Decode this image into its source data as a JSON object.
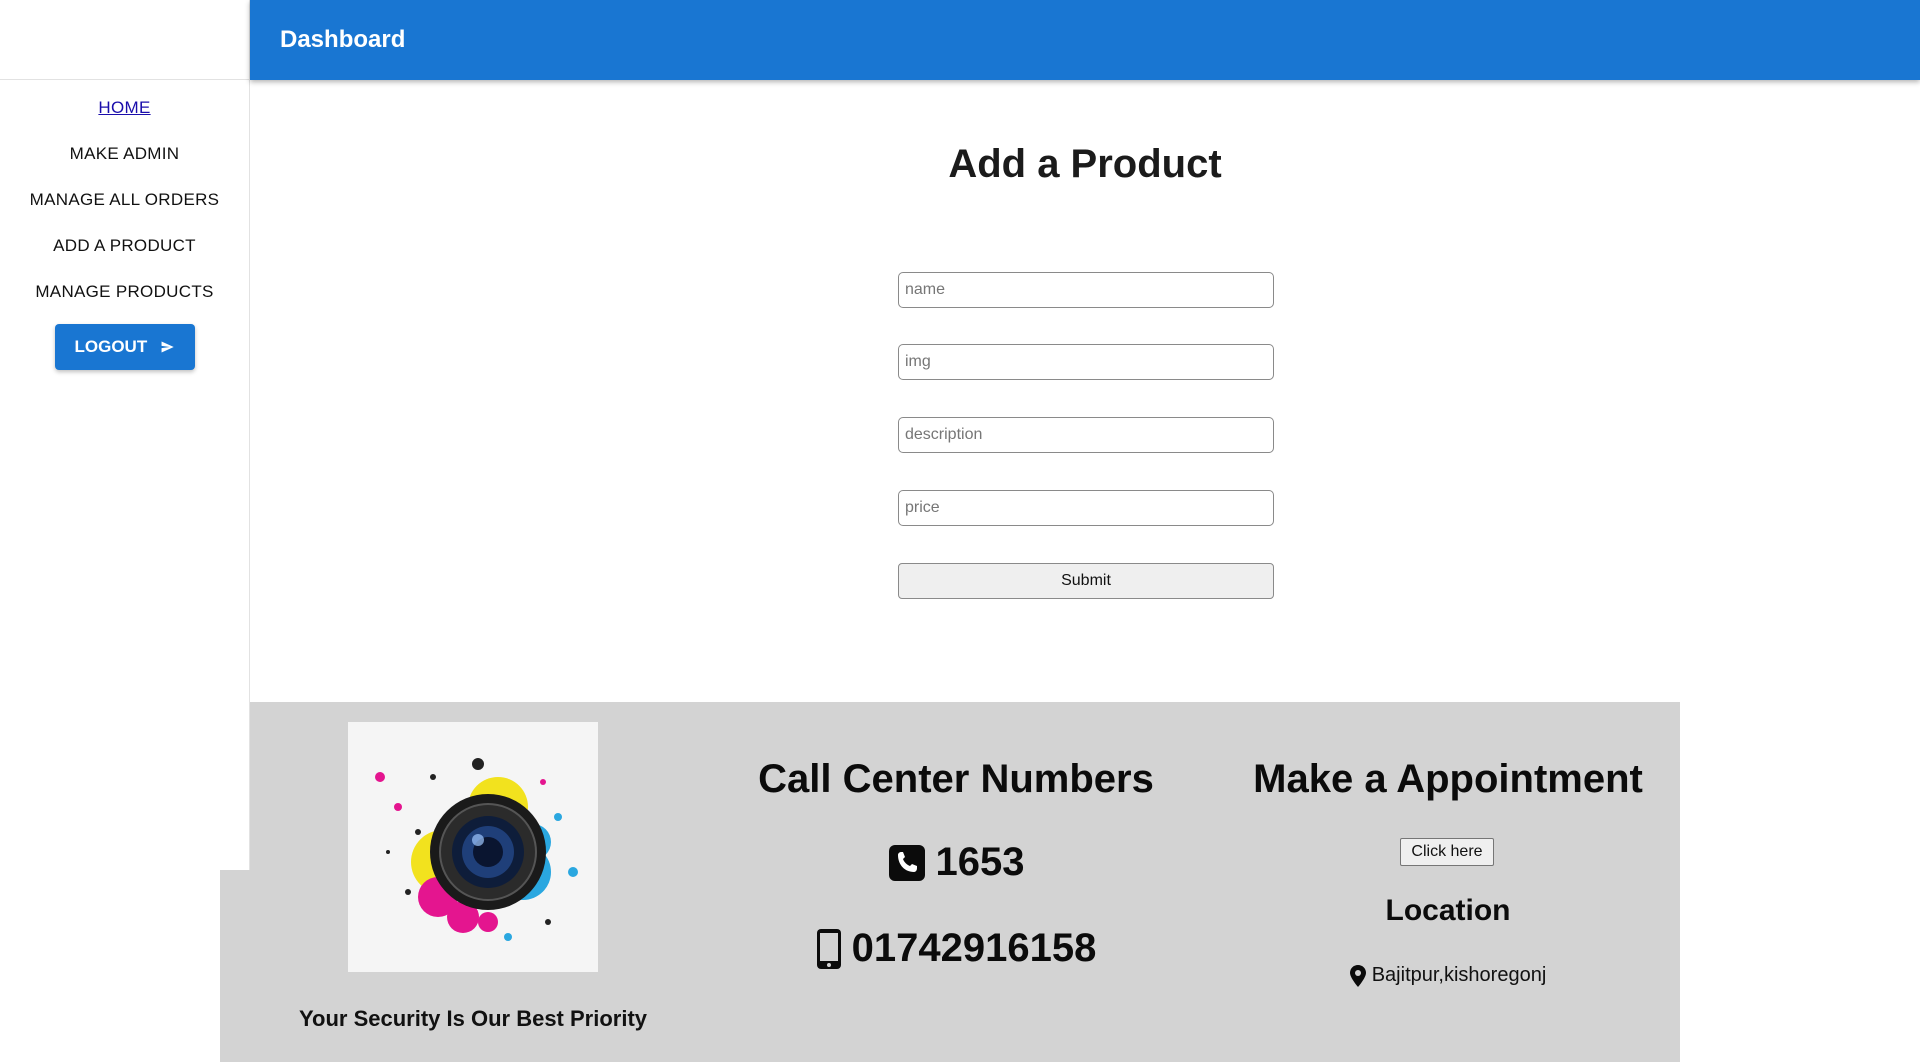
{
  "header": {
    "title": "Dashboard"
  },
  "sidebar": {
    "items": [
      {
        "label": "HOME"
      },
      {
        "label": "MAKE ADMIN"
      },
      {
        "label": "MANAGE ALL ORDERS"
      },
      {
        "label": "ADD A PRODUCT"
      },
      {
        "label": "MANAGE PRODUCTS"
      }
    ],
    "logout_label": "LOGOUT"
  },
  "main": {
    "title": "Add a Product",
    "form": {
      "name_placeholder": "name",
      "img_placeholder": "img",
      "description_placeholder": "description",
      "price_placeholder": "price",
      "submit_label": "Submit"
    }
  },
  "footer": {
    "tagline": "Your Security Is Our Best Priority",
    "call_center": {
      "title": "Call Center Numbers",
      "phone_hotline": "1653",
      "phone_mobile": "01742916158"
    },
    "appointment": {
      "title": "Make a Appointment",
      "button_label": "Click here"
    },
    "location": {
      "title": "Location",
      "address": "Bajitpur,kishoregonj"
    }
  },
  "colors": {
    "primary": "#1976d2",
    "footer_bg": "#d3d3d3"
  }
}
